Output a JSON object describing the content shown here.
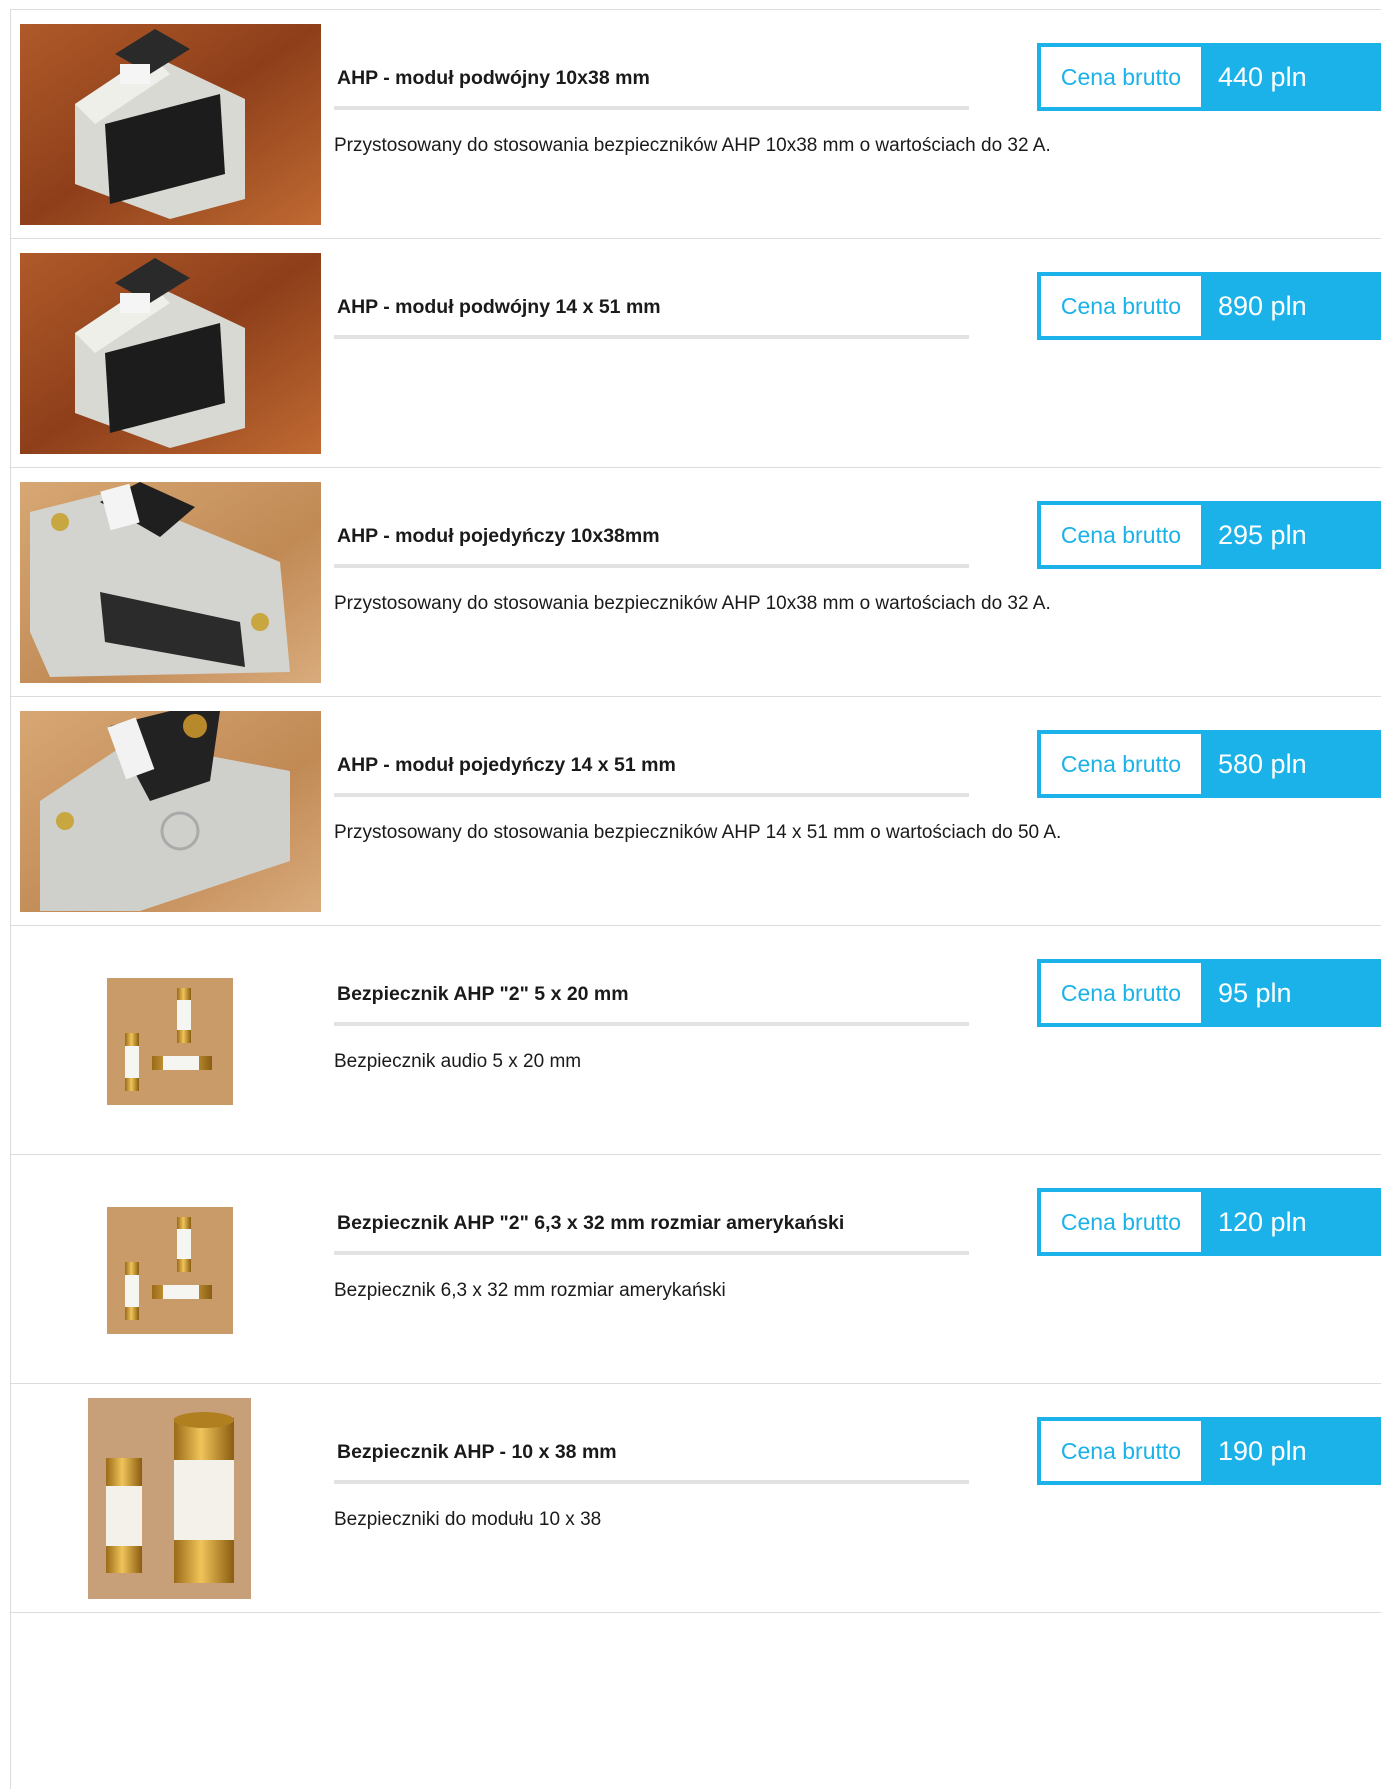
{
  "price_label": "Cena brutto",
  "colors": {
    "accent": "#1ab2e8",
    "divider": "#dcdcdc",
    "rule": "#e2e2e2"
  },
  "products": [
    {
      "title": "AHP - moduł podwójny 10x38 mm",
      "price": "440 pln",
      "description": "Przystosowany do stosowania bezpieczników AHP 10x38 mm o wartościach do 32 A."
    },
    {
      "title": "AHP - moduł podwójny 14 x 51 mm",
      "price": "890 pln",
      "description": ""
    },
    {
      "title": "AHP - moduł pojedyńczy 10x38mm",
      "price": "295 pln",
      "description": "Przystosowany do stosowania bezpieczników AHP 10x38 mm o wartościach do 32 A."
    },
    {
      "title": "AHP - moduł pojedyńczy 14 x 51 mm",
      "price": "580 pln",
      "description": "Przystosowany do stosowania bezpieczników AHP 14 x 51 mm o wartościach do 50 A."
    },
    {
      "title": "Bezpiecznik AHP \"2\" 5 x 20 mm",
      "price": "95 pln",
      "description": "Bezpiecznik audio 5 x 20 mm"
    },
    {
      "title": "Bezpiecznik AHP \"2\" 6,3 x 32 mm rozmiar amerykański",
      "price": "120 pln",
      "description": "Bezpiecznik 6,3 x 32 mm rozmiar amerykański"
    },
    {
      "title": "Bezpiecznik AHP - 10 x 38 mm",
      "price": "190 pln",
      "description": "Bezpieczniki do modułu 10 x 38"
    }
  ]
}
